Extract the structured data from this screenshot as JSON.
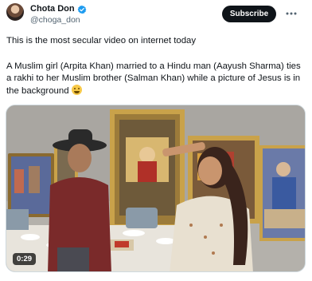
{
  "author": {
    "display_name": "Chota Don",
    "handle": "@choga_don",
    "verified_icon": "verified-badge-icon"
  },
  "actions": {
    "subscribe_label": "Subscribe",
    "more_icon": "more-options-icon"
  },
  "tweet": {
    "line1": "This is the most secular video on internet today",
    "line2": "A Muslim girl (Arpita Khan) married to a Hindu man (Aayush Sharma) ties a rakhi to her Muslim brother (Salman Khan) while a picture of Jesus is in the background",
    "emoji": "crying-face-emoji"
  },
  "media": {
    "duration": "0:29"
  },
  "colors": {
    "primary_text": "#0f1419",
    "secondary_text": "#536471",
    "verified_blue": "#1d9bf0",
    "button_bg": "#0f1419"
  }
}
